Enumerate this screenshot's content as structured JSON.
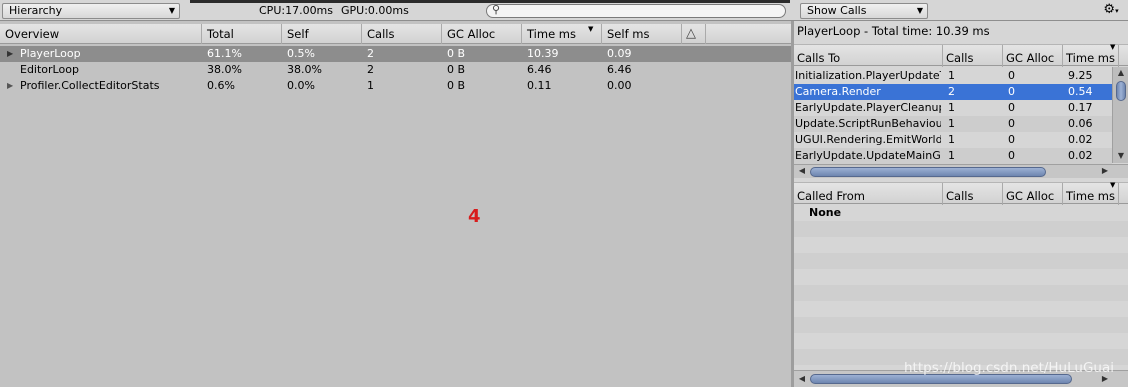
{
  "toolbar": {
    "view_mode": "Hierarchy",
    "cpu": "CPU:17.00ms",
    "gpu": "GPU:0.00ms",
    "search_value": "",
    "detail_mode": "Show Calls"
  },
  "main": {
    "columns": [
      "Overview",
      "Total",
      "Self",
      "Calls",
      "GC Alloc",
      "Time ms",
      "Self ms"
    ],
    "rows": [
      {
        "name": "PlayerLoop",
        "total": "61.1%",
        "self": "0.5%",
        "calls": "2",
        "gc": "0 B",
        "time": "10.39",
        "selfms": "0.09",
        "expandable": true,
        "selected": true
      },
      {
        "name": "EditorLoop",
        "total": "38.0%",
        "self": "38.0%",
        "calls": "2",
        "gc": "0 B",
        "time": "6.46",
        "selfms": "6.46",
        "expandable": false,
        "selected": false
      },
      {
        "name": "Profiler.CollectEditorStats",
        "total": "0.6%",
        "self": "0.0%",
        "calls": "1",
        "gc": "0 B",
        "time": "0.11",
        "selfms": "0.00",
        "expandable": true,
        "selected": false
      }
    ],
    "marker": "4"
  },
  "details": {
    "title": "PlayerLoop - Total time: 10.39 ms",
    "calls_to": {
      "columns": [
        "Calls To",
        "Calls",
        "GC Alloc",
        "Time ms"
      ],
      "rows": [
        {
          "name": "Initialization.PlayerUpdateTime",
          "calls": "1",
          "gc": "0",
          "time": "9.25"
        },
        {
          "name": "Camera.Render",
          "calls": "2",
          "gc": "0",
          "time": "0.54",
          "selected": true
        },
        {
          "name": "EarlyUpdate.PlayerCleanupCachedData",
          "calls": "1",
          "gc": "0",
          "time": "0.17"
        },
        {
          "name": "Update.ScriptRunBehaviourUpdate",
          "calls": "1",
          "gc": "0",
          "time": "0.06"
        },
        {
          "name": "UGUI.Rendering.EmitWorldScreenspaceCameraGeometry",
          "calls": "1",
          "gc": "0",
          "time": "0.02"
        },
        {
          "name": "EarlyUpdate.UpdateMainGameViewRect",
          "calls": "1",
          "gc": "0",
          "time": "0.02"
        }
      ]
    },
    "called_from": {
      "columns": [
        "Called From",
        "Calls",
        "GC Alloc",
        "Time ms"
      ],
      "rows": [
        {
          "name": "None"
        }
      ]
    }
  },
  "watermark": "https://blog.csdn.net/HuLuGuai"
}
